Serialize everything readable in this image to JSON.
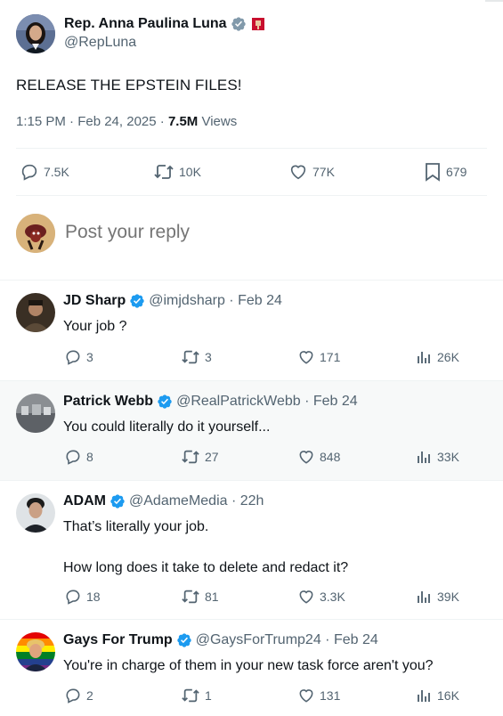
{
  "post": {
    "author_name": "Rep. Anna Paulina Luna",
    "author_handle": "@RepLuna",
    "text": "RELEASE THE EPSTEIN FILES!",
    "timestamp": "1:15 PM · Feb 24, 2025 · ",
    "views_count": "7.5M",
    "views_label": " Views",
    "stats": {
      "replies": "7.5K",
      "reposts": "10K",
      "likes": "77K",
      "bookmarks": "679"
    }
  },
  "composer": {
    "placeholder": "Post your reply"
  },
  "replies": [
    {
      "name": "JD Sharp",
      "handle": "@imjdsharp · Feb 24",
      "text": "Your job ?",
      "replies": "3",
      "reposts": "3",
      "likes": "171",
      "views": "26K"
    },
    {
      "name": "Patrick Webb",
      "handle": "@RealPatrickWebb · Feb 24",
      "text": "You could literally do it yourself...",
      "replies": "8",
      "reposts": "27",
      "likes": "848",
      "views": "33K"
    },
    {
      "name": "ADAM",
      "handle": "@AdameMedia · 22h",
      "text_line1": "That’s literally your job.",
      "text_line2": "How long does it take to delete and redact it?",
      "replies": "18",
      "reposts": "81",
      "likes": "3.3K",
      "views": "39K"
    },
    {
      "name": "Gays For Trump",
      "handle": "@GaysForTrump24 · Feb 24",
      "text": "You're in charge of them in your new task force aren't you?",
      "replies": "2",
      "reposts": "1",
      "likes": "131",
      "views": "16K"
    }
  ],
  "colors": {
    "verified_gray": "#829aab",
    "verified_blue": "#1d9bf0",
    "text_primary": "#0f1419",
    "text_secondary": "#536471",
    "divider": "#eff3f4",
    "highlight_row": "#f7f9f9"
  },
  "icons": [
    "reply-icon",
    "repost-icon",
    "like-icon",
    "bookmark-icon",
    "views-icon",
    "verified-badge-icon",
    "flag-icon"
  ]
}
